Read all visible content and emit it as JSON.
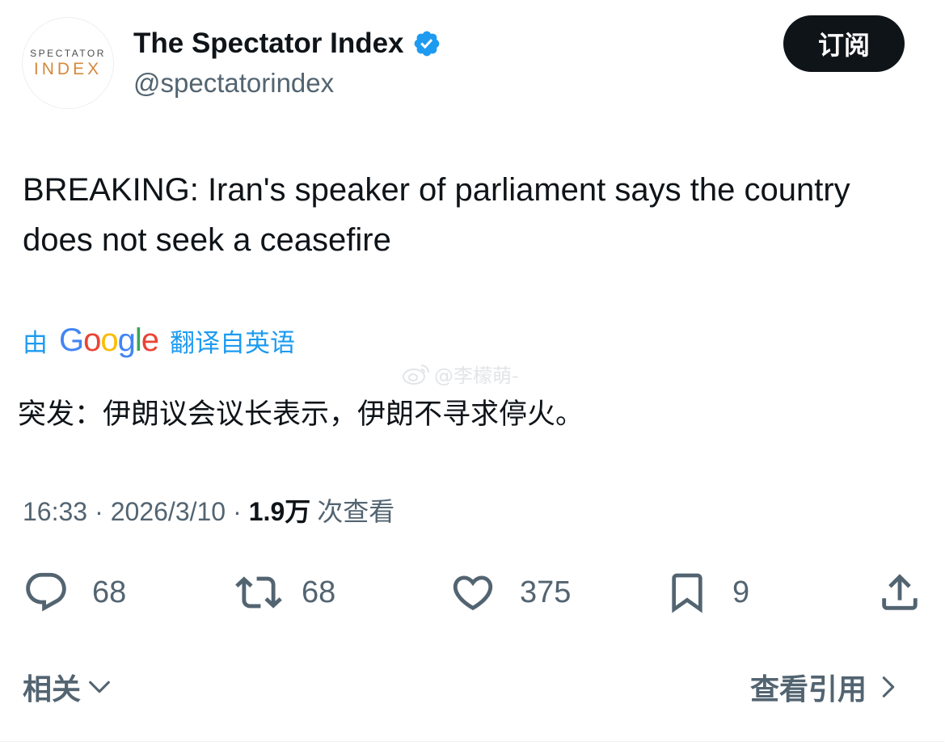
{
  "account": {
    "avatar_line1": "SPECTATOR",
    "avatar_line2": "INDEX",
    "name": "The Spectator Index",
    "handle": "@spectatorindex",
    "subscribe_label": "订阅"
  },
  "tweet": {
    "text": "BREAKING: Iran's speaker of parliament says the country does not seek a ceasefire",
    "translate_by": "由",
    "translate_brand": "Google",
    "translate_label": "翻译自英语",
    "translation": "突发：伊朗议会议长表示，伊朗不寻求停火。",
    "watermark": "@李檬萌-"
  },
  "meta": {
    "time": "16:33",
    "dot": "·",
    "date": "2026/3/10",
    "views_count": "1.9万",
    "views_label": "次查看"
  },
  "actions": {
    "replies": "68",
    "reposts": "68",
    "likes": "375",
    "bookmarks": "9"
  },
  "footer": {
    "related_label": "相关",
    "quotes_label": "查看引用"
  },
  "colors": {
    "accent": "#1d9bf0",
    "text": "#0f1419",
    "secondary": "#536471"
  }
}
